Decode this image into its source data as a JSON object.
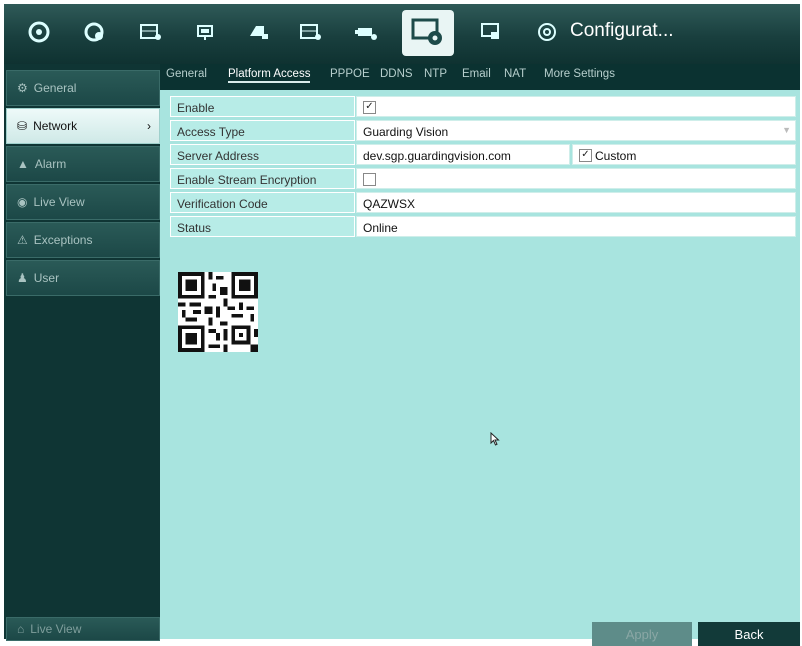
{
  "toolbar": {
    "title": "Configurat...",
    "icons": [
      "playback-icon",
      "camera-settings-icon",
      "recording-icon",
      "capture-icon",
      "hdd-icon",
      "record-config-icon",
      "network-icon",
      "configuration-icon",
      "maintenance-icon",
      "shutdown-icon"
    ]
  },
  "sidebar": {
    "items": [
      {
        "label": "General",
        "icon": "gear-icon"
      },
      {
        "label": "Network",
        "icon": "network-icon"
      },
      {
        "label": "Alarm",
        "icon": "alarm-icon"
      },
      {
        "label": "Live View",
        "icon": "eye-icon"
      },
      {
        "label": "Exceptions",
        "icon": "warning-icon"
      },
      {
        "label": "User",
        "icon": "user-icon"
      }
    ],
    "active_index": 1,
    "bottom_label": "Live View"
  },
  "tabs": [
    "General",
    "Platform Access",
    "PPPOE",
    "DDNS",
    "NTP",
    "Email",
    "NAT",
    "More Settings"
  ],
  "active_tab": "Platform Access",
  "form": {
    "enable_label": "Enable",
    "enable_checked": true,
    "access_type_label": "Access Type",
    "access_type_value": "Guarding Vision",
    "server_address_label": "Server Address",
    "server_address_value": "dev.sgp.guardingvision.com",
    "custom_label": "Custom",
    "custom_checked": true,
    "stream_encryption_label": "Enable Stream Encryption",
    "stream_encryption_checked": false,
    "verification_code_label": "Verification Code",
    "verification_code_value": "QAZWSX",
    "status_label": "Status",
    "status_value": "Online"
  },
  "buttons": {
    "apply": "Apply",
    "back": "Back"
  },
  "colors": {
    "content_bg": "#a8e4df",
    "sidebar_bg": "#0f3534",
    "accent": "#e9f5f4"
  }
}
